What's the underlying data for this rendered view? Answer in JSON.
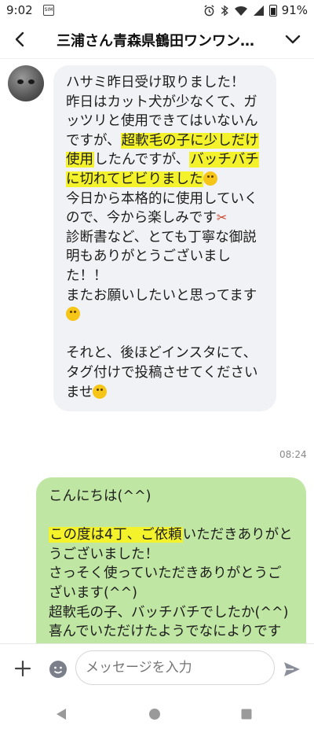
{
  "status_bar": {
    "time": "9:02",
    "battery": "91%",
    "sim_icon": "sim-card-icon",
    "icons": [
      "alarm-icon",
      "bluetooth-icon",
      "wifi-icon",
      "signal-icon",
      "battery-icon"
    ]
  },
  "header": {
    "title": "三浦さん青森県鶴田ワンワン…",
    "back_icon": "back-arrow-icon",
    "menu_icon": "chevron-down-icon"
  },
  "messages": {
    "incoming": {
      "time": "08:24",
      "p1": "ハサミ昨日受け取りました！\n昨日はカット犬が少なくて、ガッツリと使用できてはいないんですが、",
      "h1": "超軟毛の子に少しだけ使用",
      "p2": "したんですが、",
      "h2": "バッチバチに切れてビビりました",
      "p3": "\n今日から本格的に使用していくので、今から楽しみです",
      "p4": "\n診断書など、とても丁寧な御説明もありがとうございました！！\nまたお願いしたいと思ってます",
      "p5": "\n\nそれと、後ほどインスタにて、タグ付けで投稿させてくださいませ"
    },
    "outgoing": {
      "p1": "こんにちは(^^)\n\n",
      "h1": "この度は4丁、ご依頼",
      "p2": "いただきありがとうございました！\nさっそく使っていただきありがとうございます(^^)\n超軟毛の子、バッチバチでしたか(^^)\n喜んでいただけたようでなによりです"
    }
  },
  "input": {
    "placeholder": "メッセージを入力",
    "plus_icon": "plus-icon",
    "emoji_icon": "emoji-icon",
    "send_icon": "send-icon"
  },
  "nav": {
    "back": "nav-back-icon",
    "home": "nav-home-icon",
    "recents": "nav-recents-icon"
  },
  "colors": {
    "outgoing_bubble": "#bfe6a2",
    "incoming_bubble": "#f1f2f5",
    "highlight": "#f3f22b"
  }
}
